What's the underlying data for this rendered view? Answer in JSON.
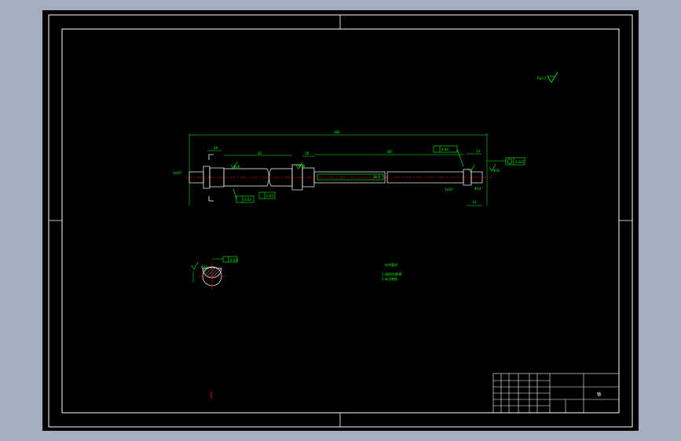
{
  "drawing": {
    "roughness_symbol": "Ra3.2",
    "overall_length_dim": "380",
    "chamfer_left": "1x45°",
    "chamfer_right": "1x45°",
    "dim_a": "46",
    "dim_b": "20",
    "dim_c": "28",
    "dim_d": "25",
    "dim_main": "185",
    "dim_e": "25",
    "dim_f": "14",
    "dim_g": "12",
    "dia_left": "Φ16",
    "dia_mid": "Φ18",
    "dia_right": "Φ16",
    "dia_tail": "Φ14",
    "keyway_label": "36.8",
    "tol_top": "0.04",
    "tol_left": "0.03",
    "tol_mid": "0.03",
    "tol_right": "0.025",
    "tol_bottom": "0.025",
    "section_tol": "0.03",
    "section_dim": "Φ16",
    "tech_title": "技术要求",
    "tech_line_1": "1.调质处理HB.",
    "tech_line_2": "2.未注倒角.",
    "part_name": "轴"
  },
  "colors": {
    "background": "#a5aebe",
    "canvas": "#000000",
    "frame": "#ffffff",
    "geometry": "#00ff00",
    "centerline": "#ff0000",
    "part_body": "#ffffff"
  }
}
